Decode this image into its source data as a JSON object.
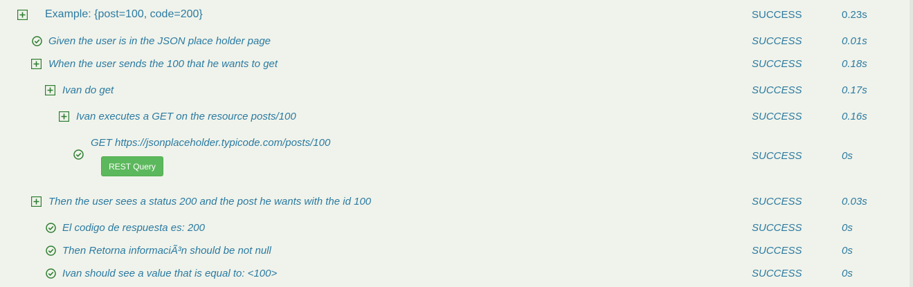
{
  "colors": {
    "background": "#f0f3eb",
    "text": "#2b7aa1",
    "icon_green": "#2e7d32",
    "button_green": "#5cb85c"
  },
  "rows": [
    {
      "label": "Example: {post=100, code=200}",
      "result": "SUCCESS",
      "duration": "0.23s",
      "icon": "expand-plus-icon"
    },
    {
      "label": "Given the user is in the JSON place holder page",
      "result": "SUCCESS",
      "duration": "0.01s",
      "icon": "check-circle-icon"
    },
    {
      "label": "When the user sends the 100 that he wants to get",
      "result": "SUCCESS",
      "duration": "0.18s",
      "icon": "expand-plus-icon"
    },
    {
      "label": "Ivan do get",
      "result": "SUCCESS",
      "duration": "0.17s",
      "icon": "expand-plus-icon"
    },
    {
      "label": "Ivan executes a GET on the resource posts/100",
      "result": "SUCCESS",
      "duration": "0.16s",
      "icon": "expand-plus-icon"
    },
    {
      "label": "GET https://jsonplaceholder.typicode.com/posts/100",
      "result": "SUCCESS",
      "duration": "0s",
      "icon": "check-circle-icon",
      "button": "REST Query"
    },
    {
      "label": "Then the user sees a status 200 and the post he wants with the id 100",
      "result": "SUCCESS",
      "duration": "0.03s",
      "icon": "expand-plus-icon"
    },
    {
      "label": "El codigo de respuesta es: 200",
      "result": "SUCCESS",
      "duration": "0s",
      "icon": "check-circle-icon"
    },
    {
      "label": "Then Retorna informaciÃ³n should be not null",
      "result": "SUCCESS",
      "duration": "0s",
      "icon": "check-circle-icon"
    },
    {
      "label": "Ivan should see a value that is equal to: <100>",
      "result": "SUCCESS",
      "duration": "0s",
      "icon": "check-circle-icon"
    }
  ]
}
